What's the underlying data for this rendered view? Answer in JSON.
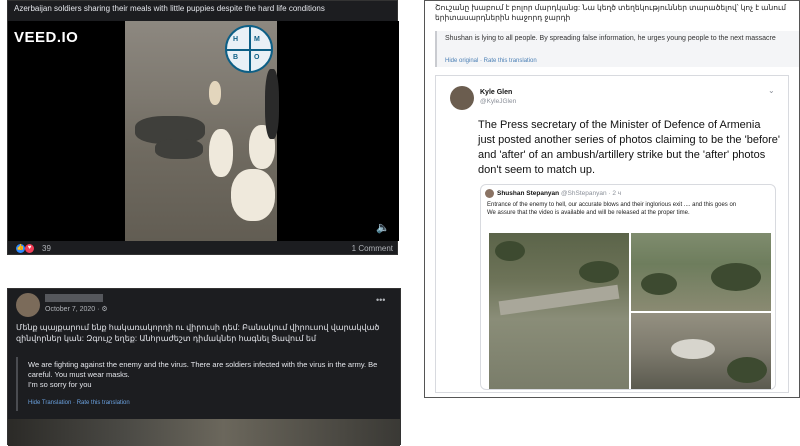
{
  "video_post": {
    "title": "Azerbaijan soldiers sharing their meals with little puppies despite the hard life conditions",
    "watermark": "VEED.IO",
    "badge_letters": [
      "H",
      "M",
      "B",
      "O"
    ],
    "reaction_count": "39",
    "comments": "1 Comment"
  },
  "tweet_post": {
    "armenian_text": "Շուշանը խաբում է բոլոր մարդկանց: Նա կեղծ տեղեկություններ տարածելով՝ կոչ է անում երիտասարդներին հաջորդ ջարդի",
    "translation": "Shushan is lying to all people. By spreading false information, he urges young people to the next massacre",
    "translation_link": "Hide original · Rate this translation",
    "tweet": {
      "name": "Kyle Glen",
      "handle": "@KyleJGlen",
      "body": "The Press secretary of the Minister of Defence of Armenia just posted another series of photos claiming to be the 'before' and 'after' of an ambush/artillery strike but the 'after' photos don't seem to match up.",
      "quoted": {
        "name": "Shushan Stepanyan",
        "handle": "@ShStepanyan · 2 ч",
        "text": "Entrance of the enemy to hell, our accurate blows and their inglorious exit .... and this goes on\nWe assure that the video is available and will be released at the proper time."
      }
    }
  },
  "fb_post": {
    "date": "October 7, 2020 · ⚙",
    "more": "•••",
    "armenian_text": "Մենք պայքարում ենք հակառակորդի ու վիրուսի դեմ: Բանակում վիրուսով վարակված զինվորներ կան: Զգույշ եղեք: Անհրաժեշտ դիմակներ հագնել Ցավում եմ",
    "translation": "We are fighting against the enemy and the virus. There are soldiers infected with the virus in the army. Be careful. You must wear masks.\nI'm so sorry for you",
    "translation_link": "Hide Translation · Rate this translation"
  }
}
